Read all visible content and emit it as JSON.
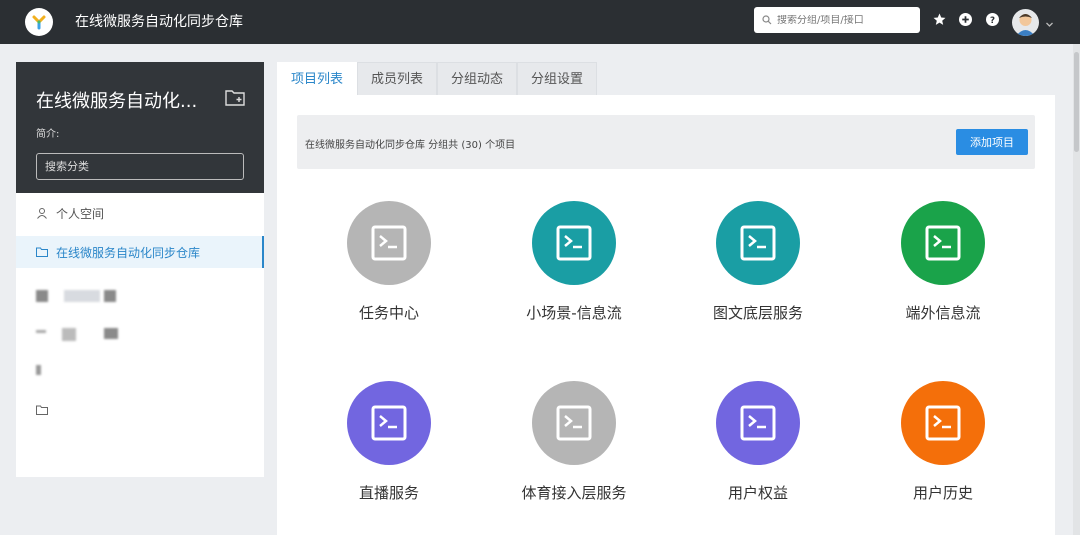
{
  "header": {
    "title": "在线微服务自动化同步仓库",
    "search_placeholder": "搜索分组/项目/接口",
    "icons": [
      "star-icon",
      "plus-icon",
      "help-icon",
      "avatar",
      "chevron-down-icon"
    ]
  },
  "sidebar": {
    "group_name": "在线微服务自动化...",
    "desc_label": "简介:",
    "search_placeholder": "搜索分类",
    "items": [
      {
        "label": "个人空间",
        "icon": "user-icon"
      },
      {
        "label": "在线微服务自动化同步仓库",
        "icon": "folder-icon",
        "active": true
      }
    ]
  },
  "tabs": [
    "项目列表",
    "成员列表",
    "分组动态",
    "分组设置"
  ],
  "banner": {
    "text": "在线微服务自动化同步仓库 分组共 (30) 个项目",
    "add_button": "添加项目"
  },
  "projects": [
    {
      "name": "任务中心",
      "color": "#b5b5b5"
    },
    {
      "name": "小场景-信息流",
      "color": "#1a9ea4"
    },
    {
      "name": "图文底层服务",
      "color": "#1a9ea4"
    },
    {
      "name": "端外信息流",
      "color": "#1aa34a"
    },
    {
      "name": "直播服务",
      "color": "#7266e0"
    },
    {
      "name": "体育接入层服务",
      "color": "#b5b5b5"
    },
    {
      "name": "用户权益",
      "color": "#7266e0"
    },
    {
      "name": "用户历史",
      "color": "#f46f0a"
    }
  ]
}
